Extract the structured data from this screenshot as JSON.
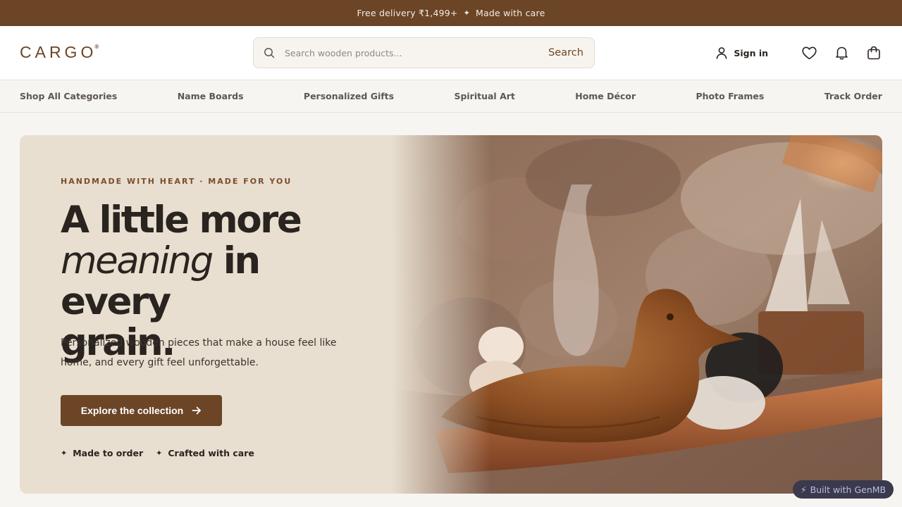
{
  "announcement": {
    "text_1": "Free delivery ₹1,499+",
    "separator": "✦",
    "text_2": "Made with care"
  },
  "header": {
    "logo": "CARGO",
    "logo_mark": "®",
    "search_placeholder": "Search wooden products...",
    "search_button": "Search",
    "signin_label": "Sign in",
    "icons": [
      "search-icon",
      "user-icon",
      "heart-icon",
      "bell-icon",
      "bag-icon"
    ]
  },
  "nav": {
    "items": [
      "Shop All Categories",
      "Name Boards",
      "Personalized Gifts",
      "Spiritual Art",
      "Home Décor",
      "Photo Frames",
      "Track Order"
    ]
  },
  "hero": {
    "eyebrow": "HANDMADE WITH HEART · MADE FOR YOU",
    "headline_1": "A little more",
    "headline_italic": "meaning",
    "headline_2": "in every",
    "headline_3": "grain.",
    "subtext": "Personalized wooden pieces that make a house feel like home, and every gift feel unforgettable.",
    "cta_label": "Explore the collection",
    "feature_mark": "✦",
    "features": [
      "Made to order",
      "Crafted with care"
    ]
  },
  "badge": {
    "icon": "⚡",
    "label": "Built with GenMB"
  },
  "colors": {
    "brand": "#6b4526",
    "hero_bg": "#e8dfd0",
    "page_bg": "#f7f5f1"
  }
}
